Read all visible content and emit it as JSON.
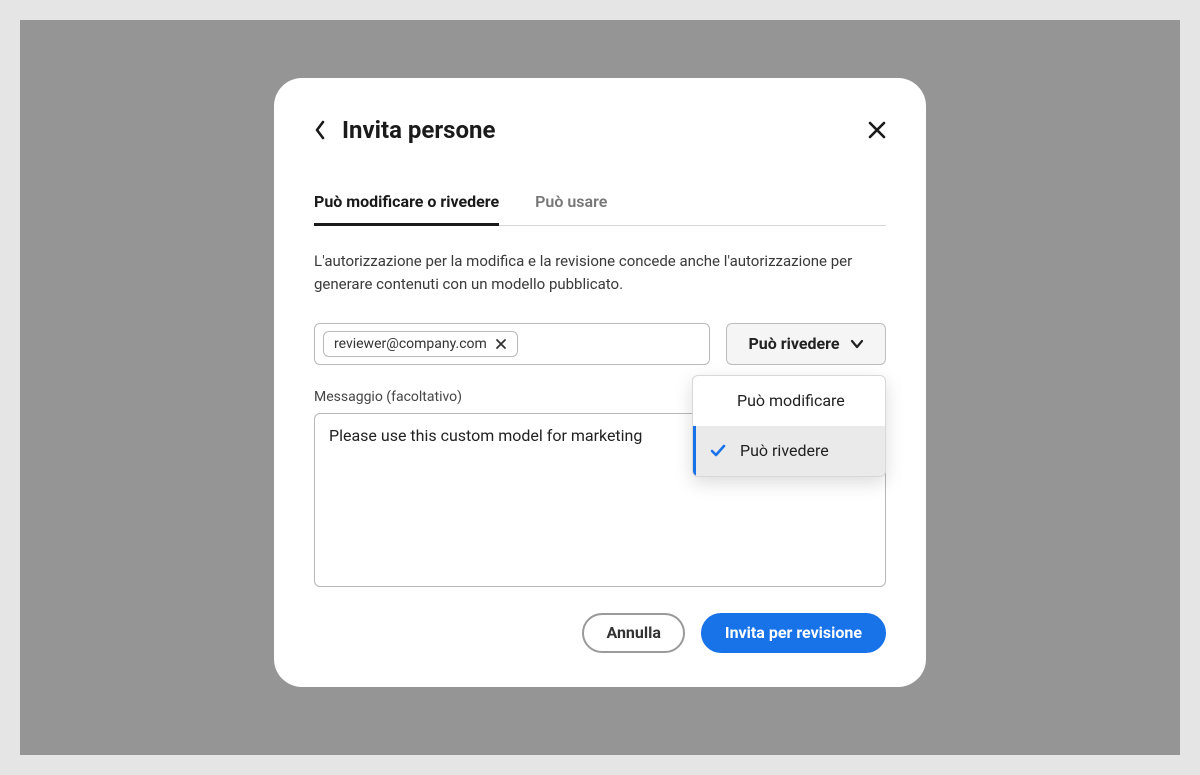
{
  "dialog": {
    "title": "Invita persone",
    "tabs": [
      {
        "label": "Può modificare o rivedere",
        "active": true
      },
      {
        "label": "Può usare",
        "active": false
      }
    ],
    "helper": "L'autorizzazione per la modifica e la revisione concede anche l'autorizzazione per generare contenuti con un modello pubblicato.",
    "email_chip": "reviewer@company.com",
    "permission_button": "Può rivedere",
    "permission_options": [
      {
        "label": "Può modificare",
        "selected": false
      },
      {
        "label": "Può rivedere",
        "selected": true
      }
    ],
    "message_label": "Messaggio (facoltativo)",
    "message_value": "Please use this custom model for marketing",
    "buttons": {
      "cancel": "Annulla",
      "submit": "Invita per revisione"
    }
  }
}
